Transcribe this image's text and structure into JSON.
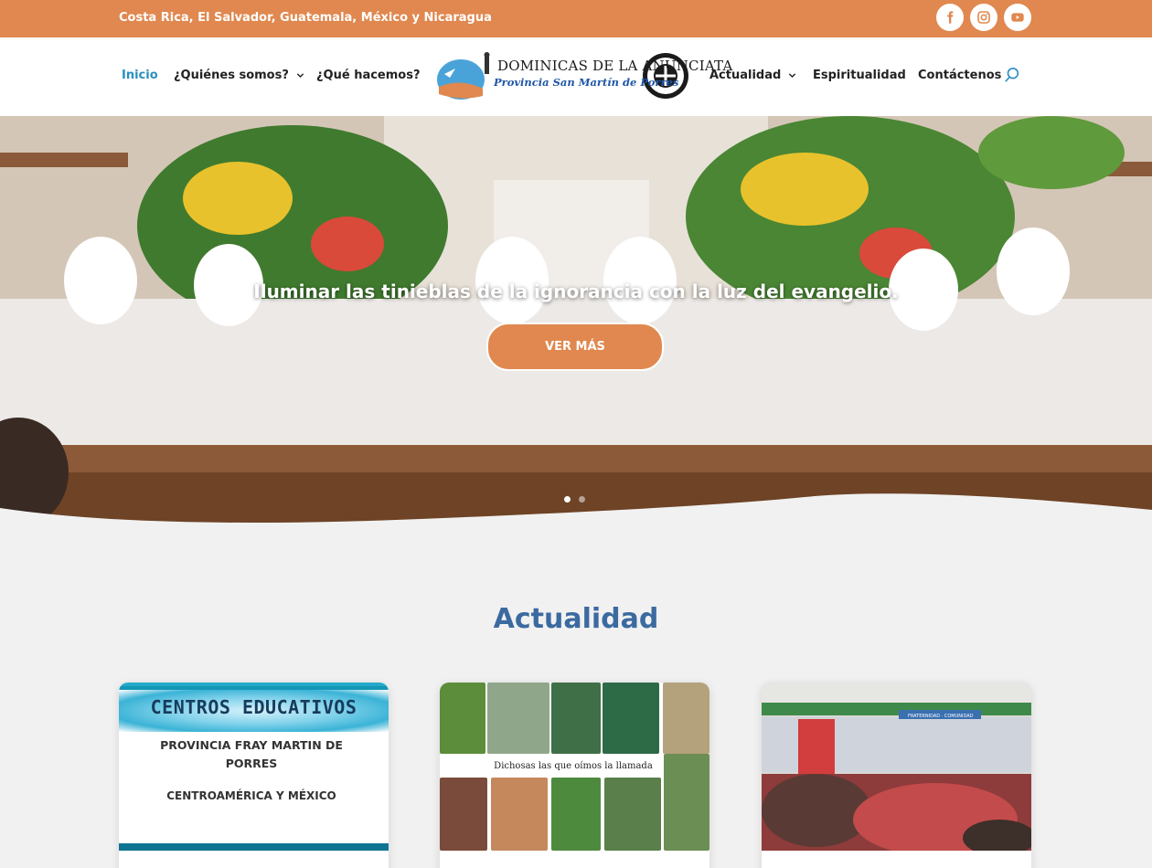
{
  "topbar": {
    "countries": "Costa Rica, El Salvador, Guatemala, México y Nicaragua",
    "social": [
      {
        "icon": "facebook-icon"
      },
      {
        "icon": "instagram-icon"
      },
      {
        "icon": "youtube-icon"
      }
    ]
  },
  "nav": {
    "left": [
      {
        "label": "Inicio",
        "active": true,
        "dropdown": false
      },
      {
        "label": "¿Quiénes somos?",
        "active": false,
        "dropdown": true
      },
      {
        "label": "¿Qué hacemos?",
        "active": false,
        "dropdown": false
      }
    ],
    "right": [
      {
        "label": "Actualidad",
        "active": false,
        "dropdown": true
      },
      {
        "label": "Espiritualidad",
        "active": false,
        "dropdown": false
      },
      {
        "label": "Contáctenos",
        "active": false,
        "dropdown": false
      }
    ],
    "search_icon": "search-icon"
  },
  "logo": {
    "line1": "DOMINICAS DE LA ANUNCIATA",
    "line2": "Provincia San Martín de Porres"
  },
  "hero": {
    "tagline": "Iluminar las tinieblas de la ignorancia con la luz del evangelio.",
    "button_label": "VER MÁS",
    "slides_total": 2,
    "active_slide": 1
  },
  "news": {
    "title": "Actualidad",
    "cards": [
      {
        "image_title": "CENTROS EDUCATIVOS",
        "image_line1": "PROVINCIA FRAY MARTIN DE",
        "image_line2": "PORRES",
        "image_line3": "CENTROAMÉRICA Y MÉXICO"
      },
      {
        "image_caption": "Dichosas las que oímos la llamada"
      },
      {
        "image_banner": "FRATERNIDAD · COMUNIDAD"
      }
    ]
  },
  "colors": {
    "accent": "#e0884f",
    "link_active": "#2a8fc1",
    "heading": "#3b6aa0",
    "background": "#f1f1f1"
  }
}
